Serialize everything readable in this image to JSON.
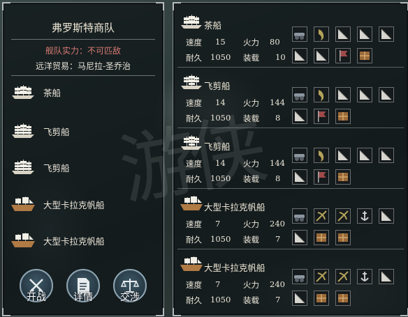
{
  "fleet": {
    "name": "弗罗斯特商队",
    "strength_label": "舰队实力：",
    "strength_value": "不可匹敌",
    "trade_label": "远洋贸易：",
    "trade_route": "马尼拉-圣乔治"
  },
  "ships": [
    {
      "name": "茶船",
      "icon": "galleon-icon"
    },
    {
      "name": "飞剪船",
      "icon": "clipper-icon"
    },
    {
      "name": "飞剪船",
      "icon": "clipper-icon"
    },
    {
      "name": "大型卡拉克帆船",
      "icon": "carrack-icon"
    },
    {
      "name": "大型卡拉克帆船",
      "icon": "carrack-icon"
    }
  ],
  "actions": [
    {
      "label": "开战",
      "icon": "crossed-swords-icon"
    },
    {
      "label": "详情",
      "icon": "document-icon"
    },
    {
      "label": "交涉",
      "icon": "scales-icon"
    }
  ],
  "stat_labels": {
    "speed": "速度",
    "firepower": "火力",
    "durability": "耐久",
    "capacity": "装载"
  },
  "details": [
    {
      "name": "茶船",
      "speed": "15",
      "firepower": "80",
      "durability": "1050",
      "capacity": "10",
      "equipment": [
        "cannon-icon",
        "figurehead-icon",
        "sail-icon",
        "sail-icon",
        "sail-icon",
        "sail-icon",
        "sail-icon",
        "flag-icon",
        "cargo-icon"
      ]
    },
    {
      "name": "飞剪船",
      "speed": "14",
      "firepower": "144",
      "durability": "1050",
      "capacity": "8",
      "equipment": [
        "cannon-icon",
        "figurehead-icon",
        "sail-icon",
        "sail-icon",
        "sail-icon",
        "sail-icon",
        "flag-icon",
        "cargo-icon"
      ]
    },
    {
      "name": "飞剪船",
      "speed": "14",
      "firepower": "144",
      "durability": "1050",
      "capacity": "8",
      "equipment": [
        "cannon-icon",
        "figurehead-icon",
        "sail-icon",
        "sail-icon",
        "sail-icon",
        "sail-icon",
        "flag-icon",
        "cargo-icon"
      ]
    },
    {
      "name": "大型卡拉克帆船",
      "speed": "7",
      "firepower": "240",
      "durability": "1050",
      "capacity": "7",
      "equipment": [
        "cannon-icon",
        "crossbow-icon",
        "crossbow-icon",
        "anchor-icon",
        "sail-icon",
        "sail-icon",
        "cargo-icon",
        "cargo-icon"
      ]
    },
    {
      "name": "大型卡拉克帆船",
      "speed": "7",
      "firepower": "240",
      "durability": "1050",
      "capacity": "7",
      "equipment": [
        "cannon-icon",
        "crossbow-icon",
        "crossbow-icon",
        "anchor-icon",
        "sail-icon",
        "sail-icon",
        "cargo-icon",
        "cargo-icon"
      ]
    }
  ],
  "colors": {
    "strength": "#d77b73",
    "frame": "#7e858a",
    "accent_ring": "#8fa6b4"
  }
}
